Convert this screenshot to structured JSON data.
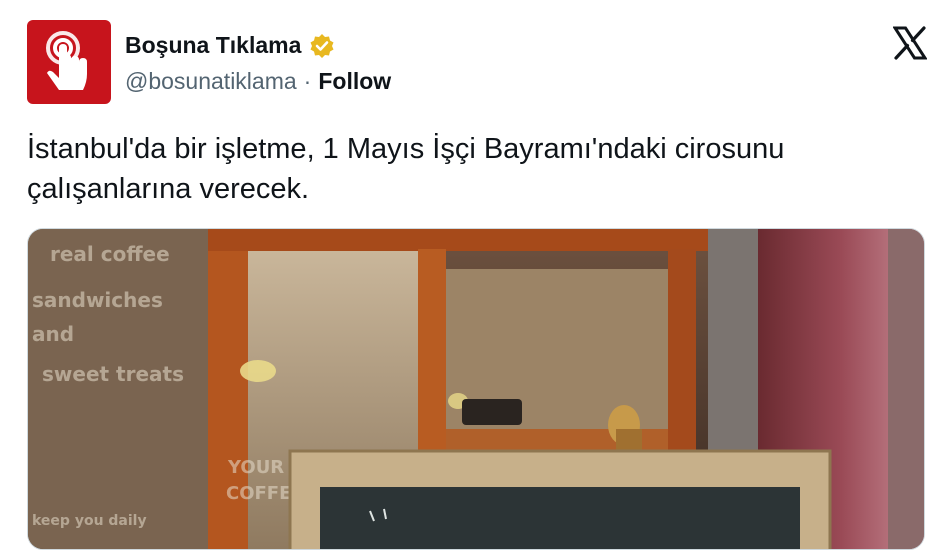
{
  "account": {
    "name": "Boşuna Tıklama",
    "handle": "@bosunatiklama",
    "separator": "·",
    "follow_label": "Follow",
    "verified_badge_color": "#e8b820",
    "avatar_color": "#c7141c"
  },
  "platform_icon": "x-logo-icon",
  "tweet": {
    "text": "İstanbul'da bir işletme, 1 Mayıs İşçi Bayramı'ndaki cirosunu çalışanlarına verecek."
  },
  "media": {
    "window_text": [
      "real coffee",
      "sandwiches",
      "and",
      "sweet treats",
      "YOUR COFFEE",
      "keep you daily"
    ]
  }
}
